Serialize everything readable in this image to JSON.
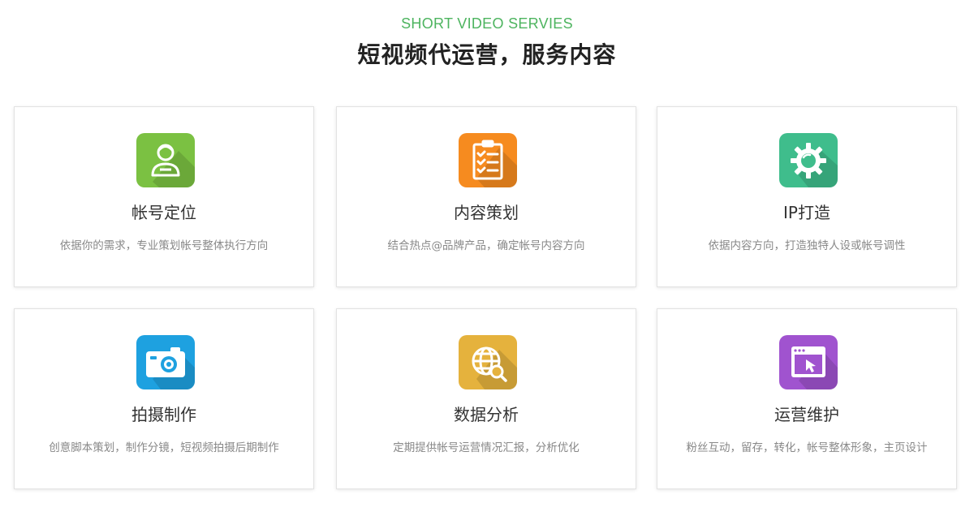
{
  "header": {
    "subtitle": "SHORT VIDEO SERVIES",
    "title": "短视频代运营，服务内容"
  },
  "colors": {
    "accent": "#4db45f",
    "title": "#222222",
    "card_title": "#333333",
    "card_desc": "#888888"
  },
  "services": [
    {
      "title": "帐号定位",
      "desc": "依据你的需求，专业策划帐号整体执行方向",
      "icon": "user-profile-icon",
      "color": "#7bc142"
    },
    {
      "title": "内容策划",
      "desc": "结合热点@品牌产品，确定帐号内容方向",
      "icon": "clipboard-checklist-icon",
      "color": "#f68b1f"
    },
    {
      "title": "IP打造",
      "desc": "依据内容方向，打造独特人设或帐号调性",
      "icon": "gear-icon",
      "color": "#3fbd8c"
    },
    {
      "title": "拍摄制作",
      "desc": "创意脚本策划，制作分镜，短视频拍摄后期制作",
      "icon": "camera-icon",
      "color": "#1ea1e0"
    },
    {
      "title": "数据分析",
      "desc": "定期提供帐号运营情况汇报，分析优化",
      "icon": "globe-search-icon",
      "color": "#e5b23d"
    },
    {
      "title": "运营维护",
      "desc": "粉丝互动，留存，转化，帐号整体形象，主页设计",
      "icon": "browser-window-cursor-icon",
      "color": "#a053cf"
    }
  ]
}
